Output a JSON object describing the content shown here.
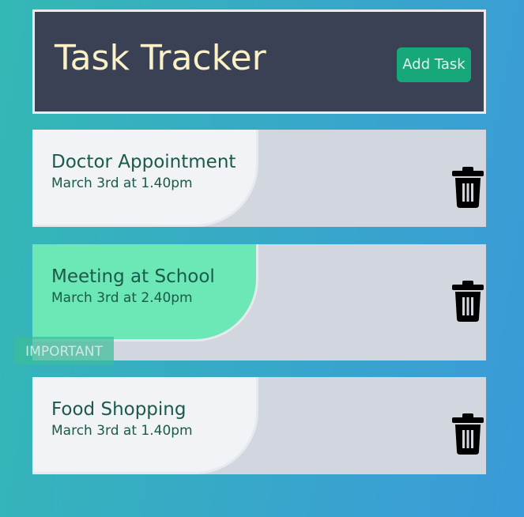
{
  "header": {
    "title": "Task Tracker",
    "add_button_label": "Add Task"
  },
  "tasks": [
    {
      "name": "Doctor Appointment",
      "date": "March 3rd at 1.40pm",
      "highlighted": false
    },
    {
      "name": "Meeting at School",
      "date": "March 3rd at 2.40pm",
      "highlighted": true,
      "badge": "IMPORTANT"
    },
    {
      "name": "Food Shopping",
      "date": "March 3rd at 1.40pm",
      "highlighted": false
    }
  ],
  "icons": {
    "delete": "trash-icon"
  },
  "colors": {
    "header_bg": "#3a4154",
    "title": "#fbf1c8",
    "accent": "#16a77a",
    "task_bg": "#d2d6de",
    "highlight": "#6be8b6",
    "task_text": "#1b5a4a"
  }
}
